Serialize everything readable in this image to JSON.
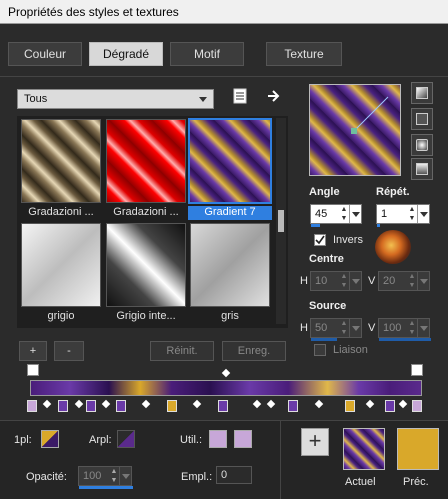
{
  "window": {
    "title": "Propriétés des styles et textures"
  },
  "tabs": [
    {
      "label": "Couleur"
    },
    {
      "label": "Dégradé"
    },
    {
      "label": "Motif"
    },
    {
      "label": "Texture"
    }
  ],
  "category": {
    "value": "Tous"
  },
  "gradients": [
    {
      "name": "Gradazioni ..."
    },
    {
      "name": "Gradazioni ..."
    },
    {
      "name": "Gradient 7"
    },
    {
      "name": "grigio"
    },
    {
      "name": "Grigio inte..."
    },
    {
      "name": "gris"
    }
  ],
  "buttons": {
    "add": "+",
    "remove": "-",
    "reset": "Réinit.",
    "save": "Enreg."
  },
  "settings": {
    "angle_label": "Angle",
    "angle_value": "45",
    "repeat_label": "Répét.",
    "repeat_value": "1",
    "invert_label": "Invers",
    "center_label": "Centre",
    "center_h_label": "H",
    "center_h_value": "10",
    "center_v_label": "V",
    "center_v_value": "20",
    "source_label": "Source",
    "source_h_label": "H",
    "source_h_value": "50",
    "source_v_label": "V",
    "source_v_value": "100",
    "link_label": "Liaison"
  },
  "bottom": {
    "first_label": "1pl:",
    "arpl_label": "Arpl:",
    "util_label": "Util.:",
    "opacity_label": "Opacité:",
    "opacity_value": "100",
    "location_label": "Empl.:",
    "location_value": "0"
  },
  "preview": {
    "current_label": "Actuel",
    "previous_label": "Préc."
  },
  "colors": {
    "accent": "#2f7fe0",
    "purple": "#5a2a8c",
    "gold": "#d9a82a",
    "lavender": "#c7a7d8"
  },
  "icons": [
    "gradient-editor-icon",
    "arrow-right-icon",
    "style-linear-icon",
    "style-rectangular-icon",
    "style-sunburst-icon",
    "style-radial-icon",
    "plus-icon"
  ]
}
